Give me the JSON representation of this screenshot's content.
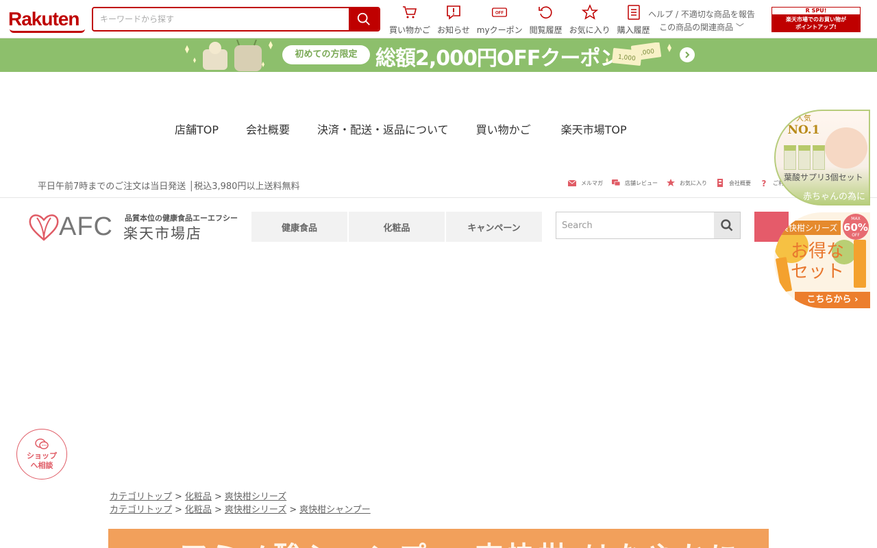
{
  "header": {
    "logo": "Rakuten",
    "search_placeholder": "キーワードから探す",
    "nav": [
      {
        "label": "買い物かご",
        "icon": "cart-icon"
      },
      {
        "label": "お知らせ",
        "icon": "notice-icon"
      },
      {
        "label": "myクーポン",
        "icon": "coupon-icon"
      },
      {
        "label": "閲覧履歴",
        "icon": "history-icon"
      },
      {
        "label": "お気に入り",
        "icon": "star-icon"
      },
      {
        "label": "購入履歴",
        "icon": "purchase-history-icon"
      }
    ],
    "help_link": "ヘルプ / 不適切な商品を報告",
    "related_link": "この商品の関連商品",
    "spu_top": "R SPU!",
    "spu_line1": "楽天市場でのお買い物が",
    "spu_line2": "ポイントアップ!"
  },
  "coupon_banner": {
    "pill": "初めての方限定",
    "headline": "総額2,000円OFFクーポン",
    "ticket_value": "1,000",
    "colors": {
      "bg": "#8dbf6c",
      "text": "#ffffff"
    }
  },
  "shop_nav": [
    "店舗TOP",
    "会社概要",
    "決済・配送・返品について",
    "買い物かご",
    "楽天市場TOP"
  ],
  "notice": "平日午前7時までのご注文は当日発送 │税込3,980円以上送料無料",
  "util_links": [
    {
      "label": "メルマガ",
      "icon": "mail-icon"
    },
    {
      "label": "店舗レビュー",
      "icon": "review-icon"
    },
    {
      "label": "お気に入り",
      "icon": "star-icon"
    },
    {
      "label": "会社概要",
      "icon": "company-icon"
    },
    {
      "label": "ご利",
      "icon": "help-icon"
    }
  ],
  "store": {
    "logo": "AFC",
    "tagline": "品質本位の健康食品エーエフシー",
    "store_name": "楽天市場店",
    "categories": [
      "健康食品",
      "化粧品",
      "キャンペーン"
    ],
    "search_placeholder": "Search"
  },
  "float_banners": {
    "b1_badge_top": "人気",
    "b1_badge": "NO.1",
    "b1_line1": "葉酸サプリ3個セット",
    "b1_line2": "赤ちゃんの為に",
    "b2_tag": "爽快柑シリーズ",
    "b2_badge_top": "MAX",
    "b2_badge": "60%",
    "b2_badge_bottom": "OFF",
    "b2_main1": "お得な",
    "b2_main2": "セット",
    "b2_cta": "こちらから ›"
  },
  "chat": {
    "line1": "ショップ",
    "line2": "へ相談"
  },
  "breadcrumbs": [
    [
      "カテゴリトップ",
      "化粧品",
      "爽快柑シリーズ"
    ],
    [
      "カテゴリトップ",
      "化粧品",
      "爽快柑シリーズ",
      "爽快柑シャンプー"
    ]
  ],
  "hero_text": "アミノ酸シャンプー 爽快柑 はなやかに"
}
